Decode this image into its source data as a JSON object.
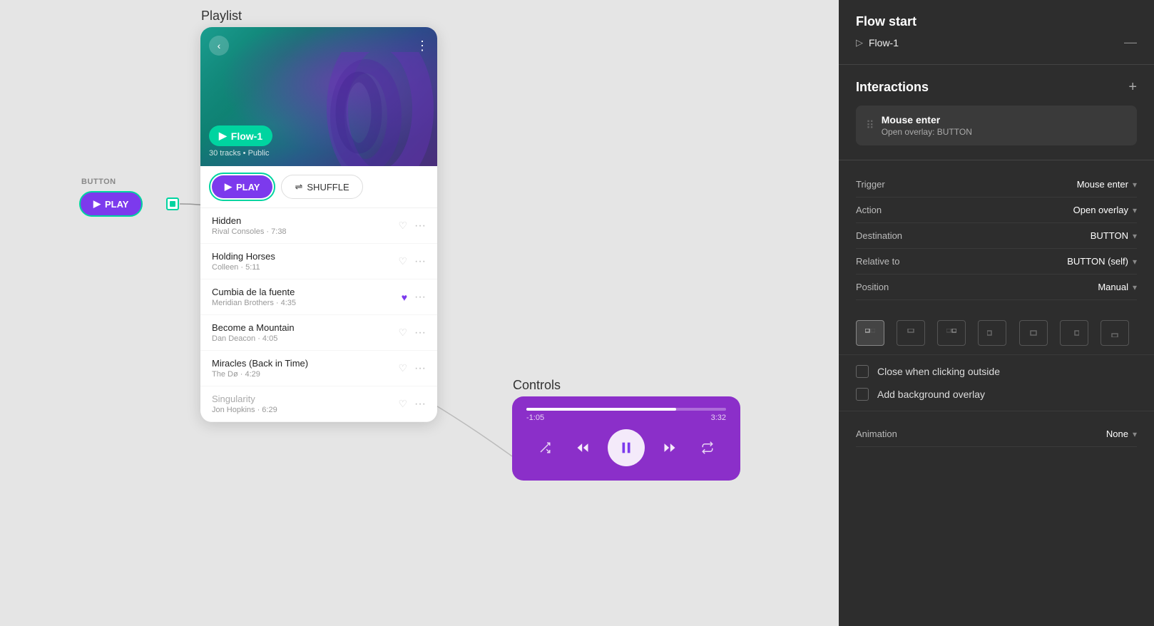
{
  "canvas": {
    "playlist_label": "Playlist",
    "controls_label": "Controls",
    "button_label": "BUTTON",
    "play_button_text": "PLAY",
    "flow_tag_text": "Flow-1",
    "album_meta": "30 tracks • Public"
  },
  "tracks": [
    {
      "name": "Hidden",
      "artist": "Rival Consoles",
      "duration": "7:38",
      "liked": false
    },
    {
      "name": "Holding Horses",
      "artist": "Colleen",
      "duration": "5:11",
      "liked": false
    },
    {
      "name": "Cumbia de la fuente",
      "artist": "Meridian Brothers",
      "duration": "4:35",
      "liked": true
    },
    {
      "name": "Become a Mountain",
      "artist": "Dan Deacon",
      "duration": "4:05",
      "liked": false
    },
    {
      "name": "Miracles (Back in Time)",
      "artist": "The Dø",
      "duration": "4:29",
      "liked": false
    },
    {
      "name": "Singularity",
      "artist": "Jon Hopkins",
      "duration": "6:29",
      "liked": false
    }
  ],
  "controls": {
    "time_elapsed": "-1:05",
    "time_total": "3:32",
    "progress_percent": 75
  },
  "right_panel": {
    "flow_start": {
      "title": "Flow start",
      "flow_item": "Flow-1"
    },
    "interactions": {
      "title": "Interactions",
      "add_label": "+",
      "card": {
        "trigger": "Mouse enter",
        "action": "Open overlay: BUTTON"
      }
    },
    "properties": {
      "trigger_label": "Trigger",
      "trigger_value": "Mouse enter",
      "action_label": "Action",
      "action_value": "Open overlay",
      "destination_label": "Destination",
      "destination_value": "BUTTON",
      "relative_to_label": "Relative to",
      "relative_to_value": "BUTTON (self)",
      "position_label": "Position",
      "position_value": "Manual"
    },
    "checkboxes": {
      "close_outside_label": "Close when clicking outside",
      "add_overlay_label": "Add background overlay"
    },
    "animation": {
      "label": "Animation",
      "value": "None"
    }
  }
}
